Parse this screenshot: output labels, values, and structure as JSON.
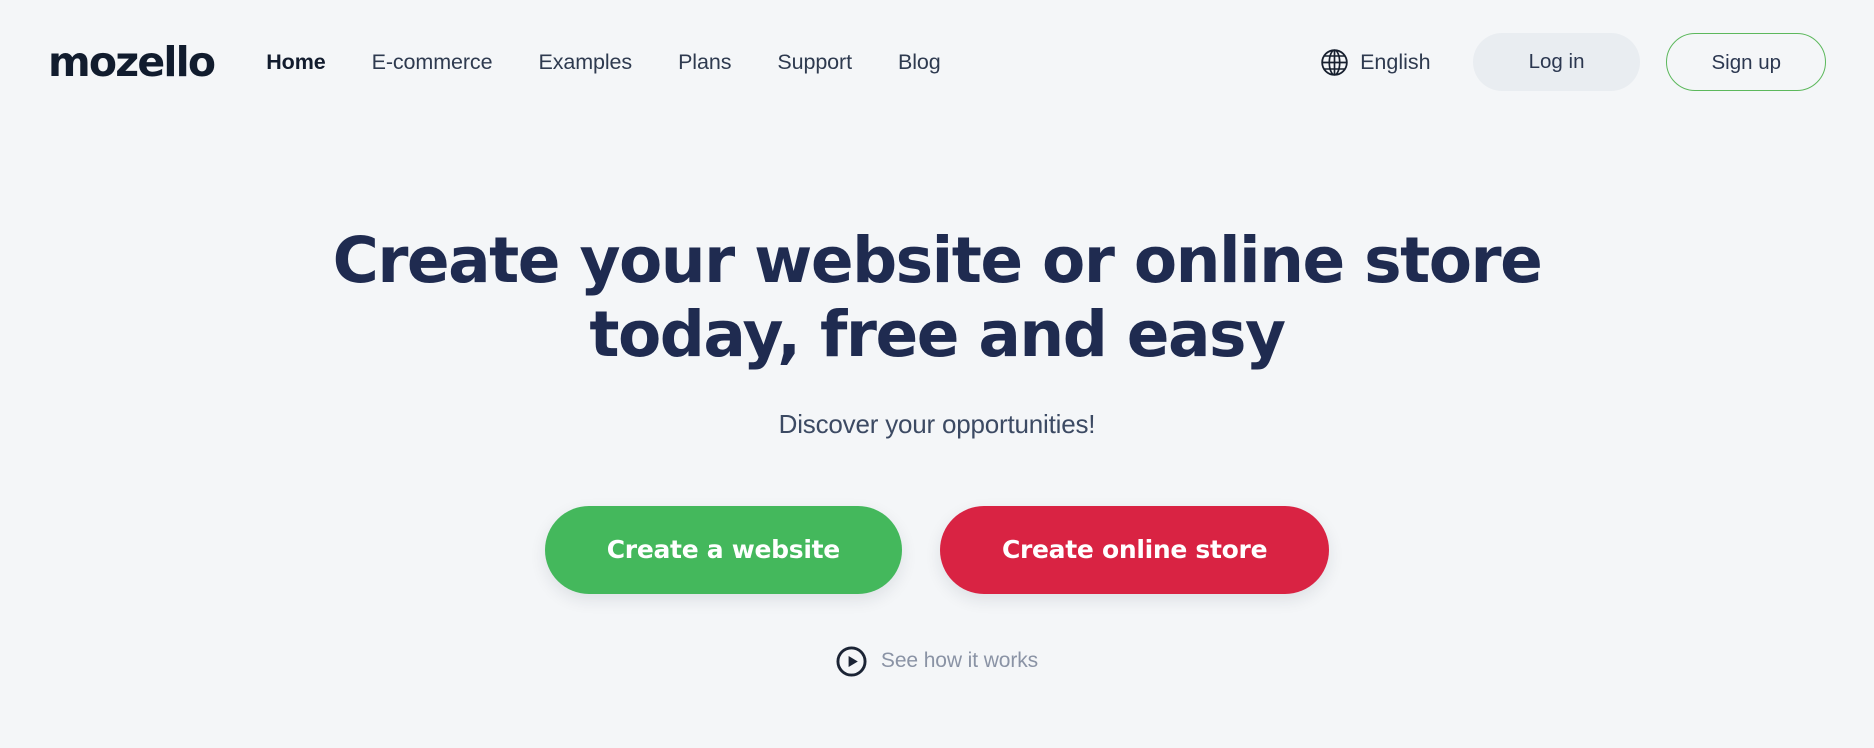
{
  "site": {
    "background_color": "#f4f6f8",
    "logo_text": "mozello",
    "logo_color": "#111c2e"
  },
  "header": {
    "nav": [
      {
        "label": "Home",
        "active": true
      },
      {
        "label": "E-commerce",
        "active": false
      },
      {
        "label": "Examples",
        "active": false
      },
      {
        "label": "Plans",
        "active": false
      },
      {
        "label": "Support",
        "active": false
      },
      {
        "label": "Blog",
        "active": false
      }
    ],
    "language": {
      "icon": "globe-icon",
      "label": "English"
    },
    "login_label": "Log in",
    "signup_label": "Sign up",
    "signup_border_color": "#5cb85c",
    "login_background_color": "#e9edf1"
  },
  "hero": {
    "headline_line1": "Create your website or online store",
    "headline_line2": "today, free and easy",
    "headline_color": "#1f2b50",
    "subtitle": "Discover your opportunities!",
    "cta_primary": {
      "label": "Create a website",
      "color": "#44b85c"
    },
    "cta_secondary": {
      "label": "Create online store",
      "color": "#d92343"
    },
    "video_link": {
      "icon": "play-circle-icon",
      "label": "See how it works"
    }
  }
}
